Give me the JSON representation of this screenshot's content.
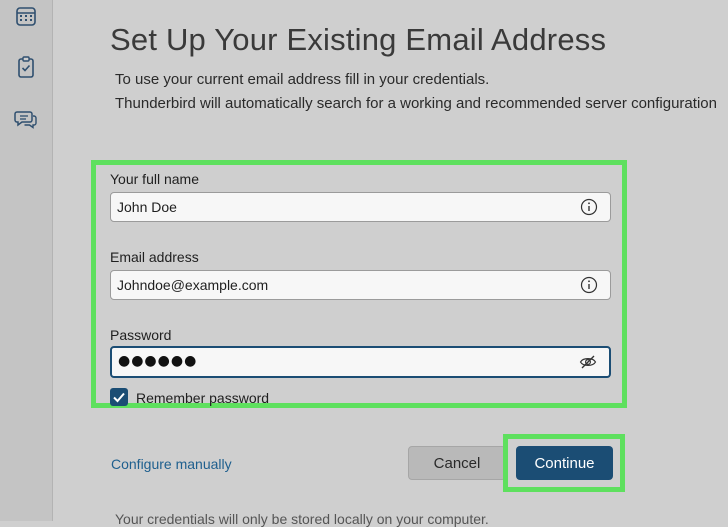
{
  "sidebar": {
    "icons": [
      "calendar-icon",
      "tasks-icon",
      "chat-icon"
    ]
  },
  "page": {
    "title": "Set Up Your Existing Email Address",
    "intro_line1": "To use your current email address fill in your credentials.",
    "intro_line2": "Thunderbird will automatically search for a working and recommended server configuration"
  },
  "form": {
    "full_name": {
      "label": "Your full name",
      "value": "John Doe"
    },
    "email": {
      "label": "Email address",
      "value": "Johndoe@example.com"
    },
    "password": {
      "label": "Password",
      "masked_value": "●●●●●●"
    },
    "remember": {
      "label": "Remember password",
      "checked": true
    }
  },
  "actions": {
    "configure_manually": "Configure manually",
    "cancel": "Cancel",
    "continue": "Continue"
  },
  "footer": {
    "note": "Your credentials will only be stored locally on your computer."
  },
  "colors": {
    "accent": "#1b4d74",
    "highlight": "#5ee05e",
    "link": "#1e5f8e",
    "background": "#cfcfcf"
  }
}
